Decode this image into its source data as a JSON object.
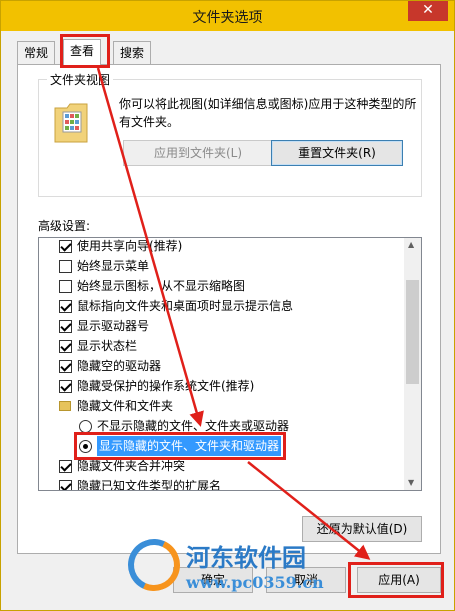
{
  "window": {
    "title": "文件夹选项",
    "close_glyph": "✕"
  },
  "tabs": [
    {
      "label": "常规",
      "active": false
    },
    {
      "label": "查看",
      "active": true
    },
    {
      "label": "搜索",
      "active": false
    }
  ],
  "folder_views": {
    "title": "文件夹视图",
    "description": "你可以将此视图(如详细信息或图标)应用于这种类型的所有文件夹。",
    "apply_button": "应用到文件夹(L)",
    "reset_button": "重置文件夹(R)"
  },
  "advanced": {
    "label": "高级设置:",
    "items": [
      {
        "type": "checkbox",
        "checked": true,
        "label": "使用共享向导(推荐)"
      },
      {
        "type": "checkbox",
        "checked": false,
        "label": "始终显示菜单"
      },
      {
        "type": "checkbox",
        "checked": false,
        "label": "始终显示图标，从不显示缩略图"
      },
      {
        "type": "checkbox",
        "checked": true,
        "label": "鼠标指向文件夹和桌面项时显示提示信息"
      },
      {
        "type": "checkbox",
        "checked": true,
        "label": "显示驱动器号"
      },
      {
        "type": "checkbox",
        "checked": true,
        "label": "显示状态栏"
      },
      {
        "type": "checkbox",
        "checked": true,
        "label": "隐藏空的驱动器"
      },
      {
        "type": "checkbox",
        "checked": true,
        "label": "隐藏受保护的操作系统文件(推荐)"
      },
      {
        "type": "folder",
        "label": "隐藏文件和文件夹"
      },
      {
        "type": "radio",
        "checked": false,
        "label": "不显示隐藏的文件、文件夹或驱动器"
      },
      {
        "type": "radio",
        "checked": true,
        "label": "显示隐藏的文件、文件夹和驱动器"
      },
      {
        "type": "checkbox",
        "checked": true,
        "label": "隐藏文件夹合并冲突"
      },
      {
        "type": "checkbox",
        "checked": true,
        "label": "隐藏已知文件类型的扩展名"
      }
    ],
    "restore_button": "还原为默认值(D)"
  },
  "footer": {
    "ok_button": "确定",
    "cancel_button": "取消",
    "apply_button": "应用(A)"
  },
  "watermark": {
    "name": "河东软件园",
    "url": "www.pc0359.cn"
  },
  "colors": {
    "titlebar": "#f2c100",
    "highlight": "#e0201a",
    "selection": "#3399ff"
  }
}
